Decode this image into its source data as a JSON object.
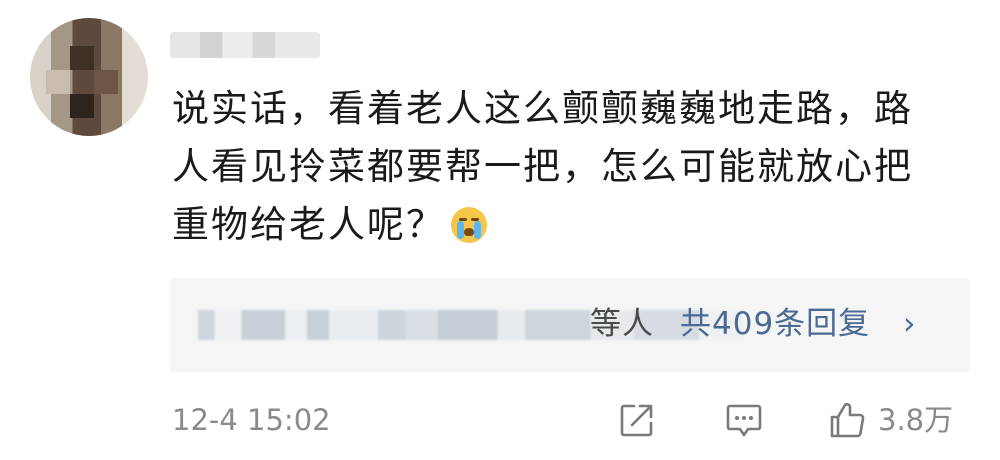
{
  "comment": {
    "author_name": "",
    "lines": [
      "说实话，看着老人这么颤颤巍巍地走路，路",
      "人看见拎菜都要帮一把，怎么可能就放心把",
      "重物给老人呢？"
    ],
    "emoji": "crying-face-emoji"
  },
  "replies": {
    "others_label": "等人",
    "count_label": "共409条回复",
    "chevron": "›"
  },
  "footer": {
    "timestamp": "12-4 15:02",
    "like_count": "3.8万"
  },
  "colors": {
    "link": "#4a6a94",
    "meta": "#8a8a8a",
    "reply_bg": "#f5f5f5"
  }
}
